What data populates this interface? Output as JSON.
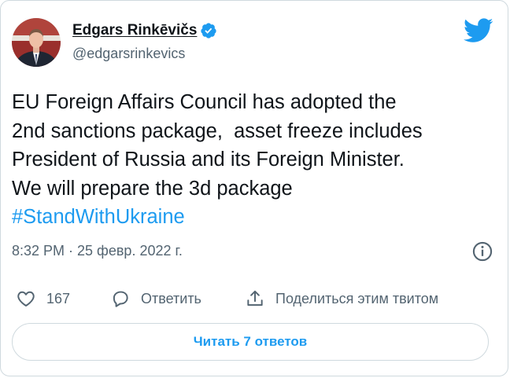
{
  "author": {
    "display_name": "Edgars Rinkēvičs",
    "handle": "@edgarsrinkevics",
    "verified": true
  },
  "tweet": {
    "lines": [
      "EU Foreign Affairs Council has adopted the",
      "2nd sanctions package,  asset freeze includes",
      "President of Russia and its Foreign Minister.",
      "We will prepare the 3d package"
    ],
    "hashtag": "#StandWithUkraine",
    "timestamp": "8:32 PM · 25 февр. 2022 г."
  },
  "actions": {
    "like_count": "167",
    "reply_label": "Ответить",
    "share_label": "Поделиться этим твитом"
  },
  "read_replies_label": "Читать 7 ответов",
  "icons": {
    "brand": "twitter-bird-icon",
    "verified": "verified-badge-icon",
    "info": "info-icon",
    "like": "heart-icon",
    "reply": "speech-bubble-icon",
    "share": "share-upload-icon"
  },
  "colors": {
    "accent": "#1d9bf0",
    "text_primary": "#0f1419",
    "text_secondary": "#536471",
    "border": "#cfd9de"
  }
}
